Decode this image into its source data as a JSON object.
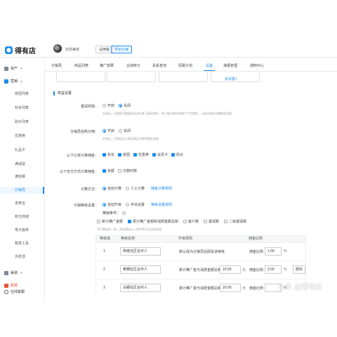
{
  "topbar": {
    "logo_text": "得有店",
    "logo_glyph": "⬢",
    "user_name": "苏苏美容",
    "trial_badge": "试用版",
    "expire_badge": "预览店铺"
  },
  "sidebar": {
    "group_assets": "资产",
    "group_marketing": "营销",
    "items": [
      "拼团列表",
      "秒杀列表",
      "砍价列表",
      "优惠券",
      "礼品卡",
      "满减送",
      "满包邮",
      "分销员",
      "发券宝",
      "积分商城",
      "电子面单",
      "裂变工具",
      "许愿池"
    ],
    "active_index": 7,
    "group_channel": "渠道",
    "group_data": "数据",
    "online_service": "在线客服"
  },
  "tabs": {
    "items": [
      "分销员",
      "商品列表",
      "推广效果",
      "业绩统计",
      "关系查询",
      "招募计划",
      "设置",
      "海报管理",
      "通知中心"
    ],
    "active_index": 6
  },
  "partial": {
    "link": "去设置>"
  },
  "section": {
    "title": "权益设置"
  },
  "form": {
    "invite_reward": {
      "label": "邀请奖励：",
      "options": [
        "开启",
        "关闭"
      ],
      "selected": 1,
      "hint": "关闭后，分销员可邀请好友成为其下级分销员，其下级分销员的推广产生佣金，上级分销员也赚佣金奖励"
    },
    "self_purchase": {
      "label": "分销员自购分佣：",
      "options": [
        "开启",
        "关闭"
      ],
      "selected": 0,
      "hint": "开启后，分销员自己购买商品可获得佣金奖励"
    },
    "order_commission": {
      "label": "以下订单计算佣金：",
      "options": [
        "秒杀",
        "拼团",
        "优惠券",
        "会员卡",
        "砍价"
      ]
    },
    "payment_commission": {
      "label": "以下支付方式计算佣金：",
      "options": [
        "余额",
        "次数时数"
      ],
      "checked": [
        true,
        false
      ]
    },
    "calc_method": {
      "label": "计算方式：",
      "options": [
        "自动计算",
        "人工计算"
      ],
      "selected": 0,
      "link": "佣金计算规则"
    },
    "level_setting": {
      "label": "分销等级设置：",
      "options": [
        "自动升级",
        "手动设置"
      ],
      "selected": 0,
      "link": "等级设置规则"
    },
    "level_condition": {
      "label": "等级条件：",
      "options": [
        "累计推广金额",
        "累计推广金额和消费金额总和",
        "客户数",
        "邀请数",
        "二级邀请数"
      ],
      "checked": [
        false,
        true,
        false,
        false,
        false
      ],
      "hint": "至少需勾选一项，同时满足以上条件将可以自动升级"
    }
  },
  "table": {
    "headers": [
      "等级值",
      "等级名称",
      "升级规则",
      "佣金比例"
    ],
    "rows": [
      {
        "level": "1",
        "name": "高级社区合伙人",
        "rule": "默认成为分销员后即是该等级",
        "ratio_label": "佣金比例",
        "ratio": "1.00",
        "unit": "%",
        "amount": "",
        "delete": ""
      },
      {
        "level": "2",
        "name": "黄钢社区合伙人",
        "rule": "累计推广金与消费金额总和达",
        "ratio_label": "佣金比例",
        "ratio": "2.00",
        "unit": "%",
        "amount": "10.00",
        "amount_unit": "元",
        "delete": "删除"
      },
      {
        "level": "3",
        "name": "白银社区合伙人",
        "rule": "累计推广金与消费金额总和达",
        "ratio_label": "佣金比例",
        "ratio": "",
        "unit": "%",
        "amount": "20.00",
        "amount_unit": "元",
        "delete": ""
      }
    ]
  },
  "watermark": "头条 @得有店",
  "colors": {
    "accent": "#1a8bf0"
  }
}
